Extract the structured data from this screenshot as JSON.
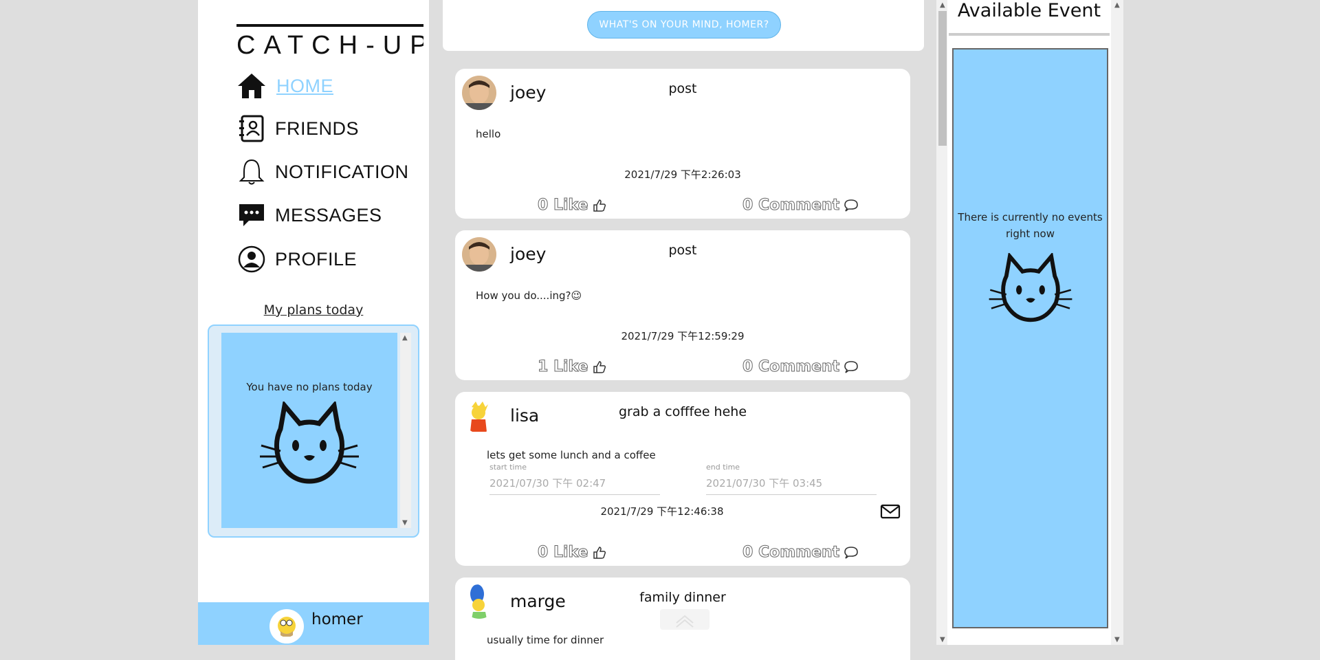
{
  "sidebar": {
    "logo_text": "CATCH-UP",
    "nav": [
      {
        "label": "HOME",
        "icon": "home-icon"
      },
      {
        "label": "FRIENDS",
        "icon": "contacts-icon"
      },
      {
        "label": "NOTIFICATION",
        "icon": "bell-icon"
      },
      {
        "label": "MESSAGES",
        "icon": "chat-icon"
      },
      {
        "label": "PROFILE",
        "icon": "user-circle-icon"
      }
    ],
    "plans_title": "My plans today",
    "plans_empty": "You have no plans today",
    "user_name": "homer"
  },
  "composer": {
    "button_label": "WHAT'S ON YOUR MIND, HOMER?"
  },
  "posts": [
    {
      "author": "joey",
      "title": "post",
      "content": "hello",
      "timestamp": "2021/7/29 下午2:26:03",
      "likes": "0 Like",
      "comments": "0 Comment"
    },
    {
      "author": "joey",
      "title": "post",
      "content": "How you do....ing?😉",
      "timestamp": "2021/7/29 下午12:59:29",
      "likes": "1 Like",
      "comments": "0 Comment"
    },
    {
      "author": "lisa",
      "title": "grab a cofffee hehe",
      "content": "lets get some lunch and a coffee",
      "start_label": "start time",
      "start_value": "2021/07/30 下午 02:47",
      "end_label": "end time",
      "end_value": "2021/07/30 下午 03:45",
      "timestamp": "2021/7/29 下午12:46:38",
      "likes": "0 Like",
      "comments": "0 Comment"
    },
    {
      "author": "marge",
      "title": "family dinner",
      "content": "usually time for dinner"
    }
  ],
  "events": {
    "title": "Available Event",
    "empty_text": "There is currently no events right now"
  },
  "colors": {
    "accent": "#8fd2ff",
    "background": "#dedede"
  }
}
